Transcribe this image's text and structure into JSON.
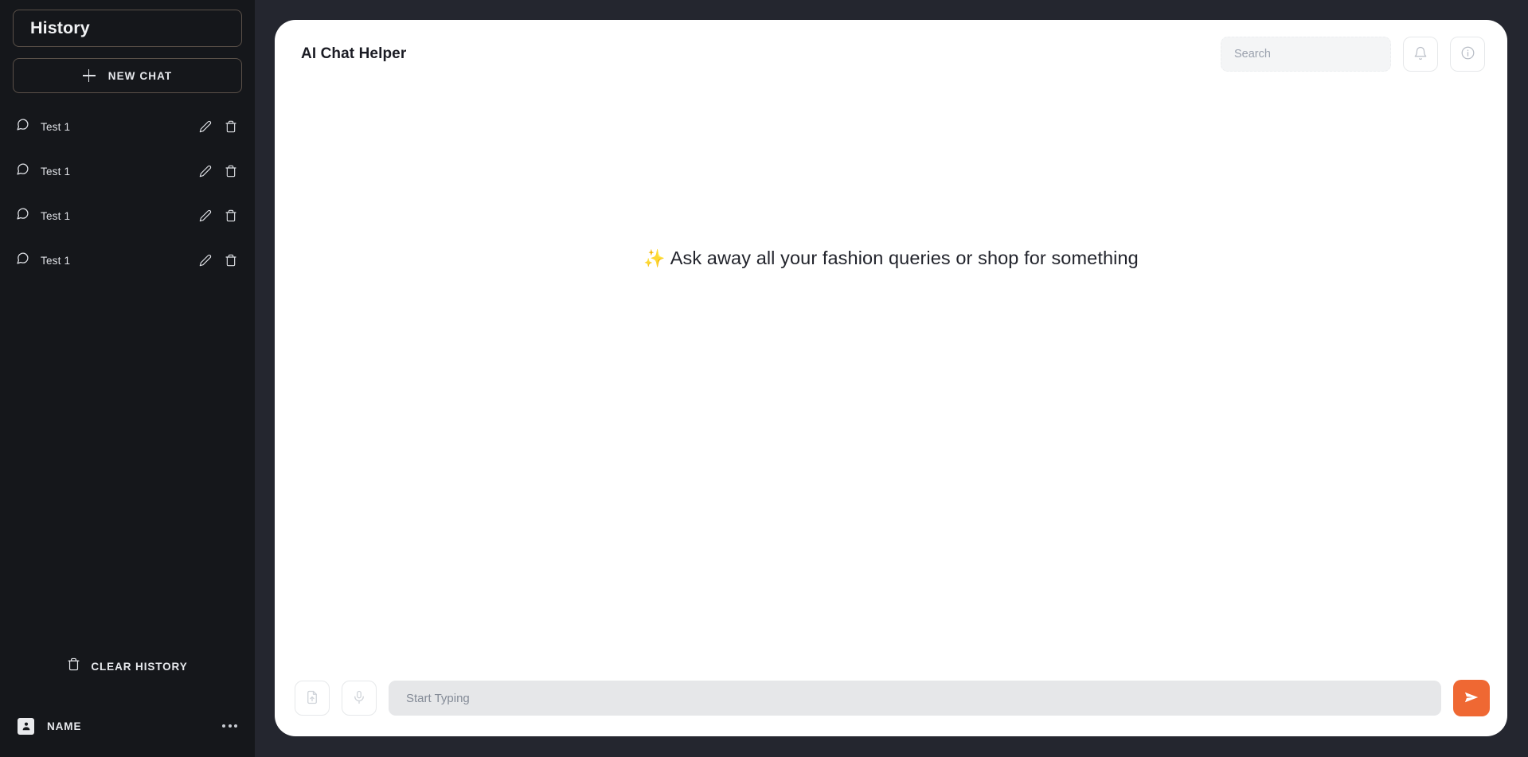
{
  "sidebar": {
    "history_title": "History",
    "new_chat_label": "NEW CHAT",
    "new_chat_icon": "plus-icon",
    "chats": [
      {
        "label": "Test 1",
        "icon": "chat-bubble-icon",
        "edit_icon": "pencil-icon",
        "delete_icon": "trash-icon"
      },
      {
        "label": "Test 1",
        "icon": "chat-bubble-icon",
        "edit_icon": "pencil-icon",
        "delete_icon": "trash-icon"
      },
      {
        "label": "Test 1",
        "icon": "chat-bubble-icon",
        "edit_icon": "pencil-icon",
        "delete_icon": "trash-icon"
      },
      {
        "label": "Test 1",
        "icon": "chat-bubble-icon",
        "edit_icon": "pencil-icon",
        "delete_icon": "trash-icon"
      }
    ],
    "clear_history_label": "CLEAR HISTORY",
    "clear_history_icon": "trash-icon",
    "user_name": "NAME",
    "user_avatar_icon": "person-icon",
    "user_more_icon": "ellipsis-icon"
  },
  "header": {
    "title": "AI Chat Helper",
    "search_placeholder": "Search",
    "search_value": "",
    "notification_icon": "bell-icon",
    "info_icon": "info-icon"
  },
  "body": {
    "sparkle": "✨",
    "empty_message": "Ask away all your fashion queries or shop for something"
  },
  "footer": {
    "attach_icon": "file-upload-icon",
    "mic_icon": "microphone-icon",
    "input_placeholder": "Start Typing",
    "input_value": "",
    "send_icon": "send-icon"
  },
  "colors": {
    "accent": "#ef6833",
    "sidebar_bg": "#15171b",
    "page_bg": "#24262f",
    "panel_bg": "#ffffff",
    "sparkle": "#f0b23c"
  }
}
